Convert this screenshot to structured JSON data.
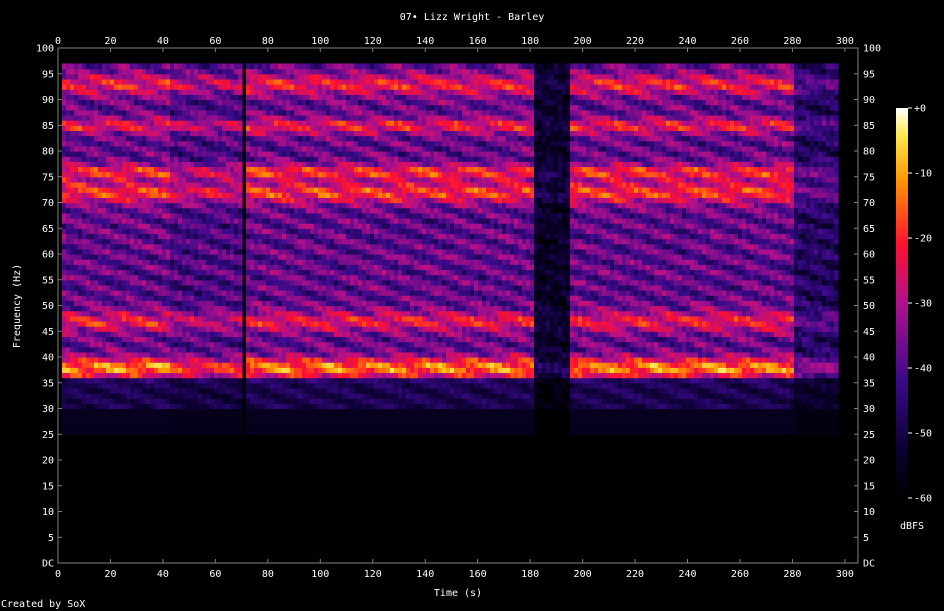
{
  "chart_data": {
    "type": "heatmap",
    "title": "07• Lizz Wright - Barley",
    "xlabel": "Time (s)",
    "ylabel": "Frequency (Hz)",
    "x_ticks": [
      "0",
      "20",
      "40",
      "60",
      "80",
      "100",
      "120",
      "140",
      "160",
      "180",
      "200",
      "220",
      "240",
      "260",
      "280",
      "300"
    ],
    "xlim": [
      0,
      305
    ],
    "y_ticks": [
      "DC",
      "5",
      "10",
      "15",
      "20",
      "25",
      "30",
      "35",
      "40",
      "45",
      "50",
      "55",
      "60",
      "65",
      "70",
      "75",
      "80",
      "85",
      "90",
      "95",
      "100"
    ],
    "ylim": [
      0,
      100
    ],
    "colorbar": {
      "label": "dBFS",
      "ticks": [
        "+0",
        "-10",
        "-20",
        "-30",
        "-40",
        "-50",
        "-60"
      ],
      "range": [
        -60,
        0
      ]
    },
    "credit": "Created by SoX",
    "colors": {
      "background": "#000000",
      "text": "#ffffff",
      "axis": "#808080"
    },
    "segments": [
      {
        "start": 2,
        "end": 42,
        "level": 0.95
      },
      {
        "start": 43,
        "end": 70,
        "level": 0.82
      },
      {
        "start": 72,
        "end": 182,
        "level": 0.95
      },
      {
        "start": 182,
        "end": 195,
        "level": 0.25
      },
      {
        "start": 195,
        "end": 280,
        "level": 0.95
      },
      {
        "start": 280,
        "end": 297,
        "level": 0.55
      }
    ],
    "bands": [
      {
        "freq": 38,
        "width": 2,
        "level": 1.0
      },
      {
        "freq": 47,
        "width": 2,
        "level": 0.6
      },
      {
        "freq": 72,
        "width": 2,
        "level": 0.75
      },
      {
        "freq": 76,
        "width": 1.5,
        "level": 0.7
      },
      {
        "freq": 85,
        "width": 1.5,
        "level": 0.6
      },
      {
        "freq": 93,
        "width": 2,
        "level": 0.6
      }
    ]
  }
}
